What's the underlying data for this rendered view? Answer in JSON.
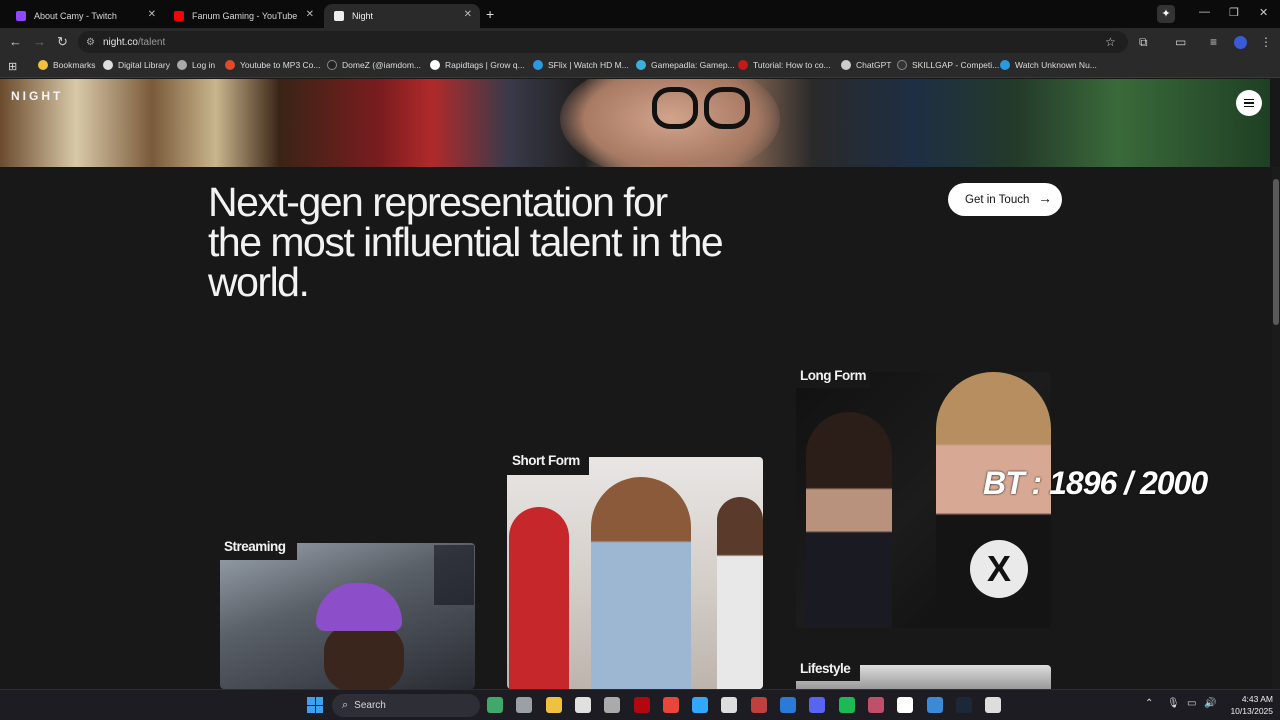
{
  "browser": {
    "tabs": [
      {
        "label": "About Camy - Twitch",
        "favicon_color": "#9146ff",
        "active": false
      },
      {
        "label": "Fanum Gaming - YouTube",
        "favicon_color": "#ff0000",
        "active": false
      },
      {
        "label": "Night",
        "favicon_color": "#eeeeee",
        "active": true
      }
    ],
    "new_tab": "+",
    "close_glyph": "✕",
    "address": {
      "host": "night.co",
      "path": "/talent"
    },
    "bookmarks": [
      {
        "label": "Bookmarks",
        "icon_color": "#f0c040"
      },
      {
        "label": "Digital Library",
        "icon_color": "#dddddd"
      },
      {
        "label": "Log in",
        "icon_color": "#aaaaaa"
      },
      {
        "label": "Youtube to MP3 Co...",
        "icon_color": "#e04a2a"
      },
      {
        "label": "DomeZ (@iamdom...",
        "icon_color": "#222222"
      },
      {
        "label": "Rapidtags | Grow q...",
        "icon_color": "#ffffff"
      },
      {
        "label": "SFlix | Watch HD M...",
        "icon_color": "#2a9ae0"
      },
      {
        "label": "Gamepadla: Gamep...",
        "icon_color": "#3ab0d8"
      },
      {
        "label": "Tutorial: How to co...",
        "icon_color": "#c01a1a"
      },
      {
        "label": "ChatGPT",
        "icon_color": "#cccccc"
      },
      {
        "label": "SKILLGAP - Competi...",
        "icon_color": "#333333"
      },
      {
        "label": "Watch Unknown Nu...",
        "icon_color": "#2a9ae0"
      }
    ]
  },
  "page": {
    "logo": "NIGHT",
    "headline": "Next-gen representation for the most influential talent in the world.",
    "cta_label": "Get in Touch",
    "cta_arrow": "→",
    "categories": [
      {
        "label": "Streaming"
      },
      {
        "label": "Short Form"
      },
      {
        "label": "Long Form"
      },
      {
        "label": "Lifestyle"
      }
    ],
    "long_form_badge": "X"
  },
  "overlay_text": "BT : 1896 / 2000",
  "taskbar": {
    "search_label": "Search",
    "time": "4:43 AM",
    "date": "10/13/2025",
    "apps": [
      {
        "name": "browser-app-icon",
        "color": "#3fa86a"
      },
      {
        "name": "task-view-icon",
        "color": "#9aa0a6"
      },
      {
        "name": "file-explorer-icon",
        "color": "#f0c040"
      },
      {
        "name": "store-icon",
        "color": "#e0e0e0"
      },
      {
        "name": "app-icon",
        "color": "#aaaaaa"
      },
      {
        "name": "netflix-icon",
        "color": "#b00710"
      },
      {
        "name": "chrome-icon",
        "color": "#e8453c"
      },
      {
        "name": "photoshop-icon",
        "color": "#31a8ff"
      },
      {
        "name": "app-icon",
        "color": "#dddddd"
      },
      {
        "name": "app-icon",
        "color": "#c04040"
      },
      {
        "name": "app-icon",
        "color": "#2a7ad8"
      },
      {
        "name": "discord-icon",
        "color": "#5865f2"
      },
      {
        "name": "spotify-icon",
        "color": "#1db954"
      },
      {
        "name": "app-icon",
        "color": "#c0506a"
      },
      {
        "name": "app-icon",
        "color": "#ffffff"
      },
      {
        "name": "app-icon",
        "color": "#3a8ad8"
      },
      {
        "name": "steam-icon",
        "color": "#1b2838"
      },
      {
        "name": "vr-icon",
        "color": "#dddddd"
      }
    ]
  }
}
